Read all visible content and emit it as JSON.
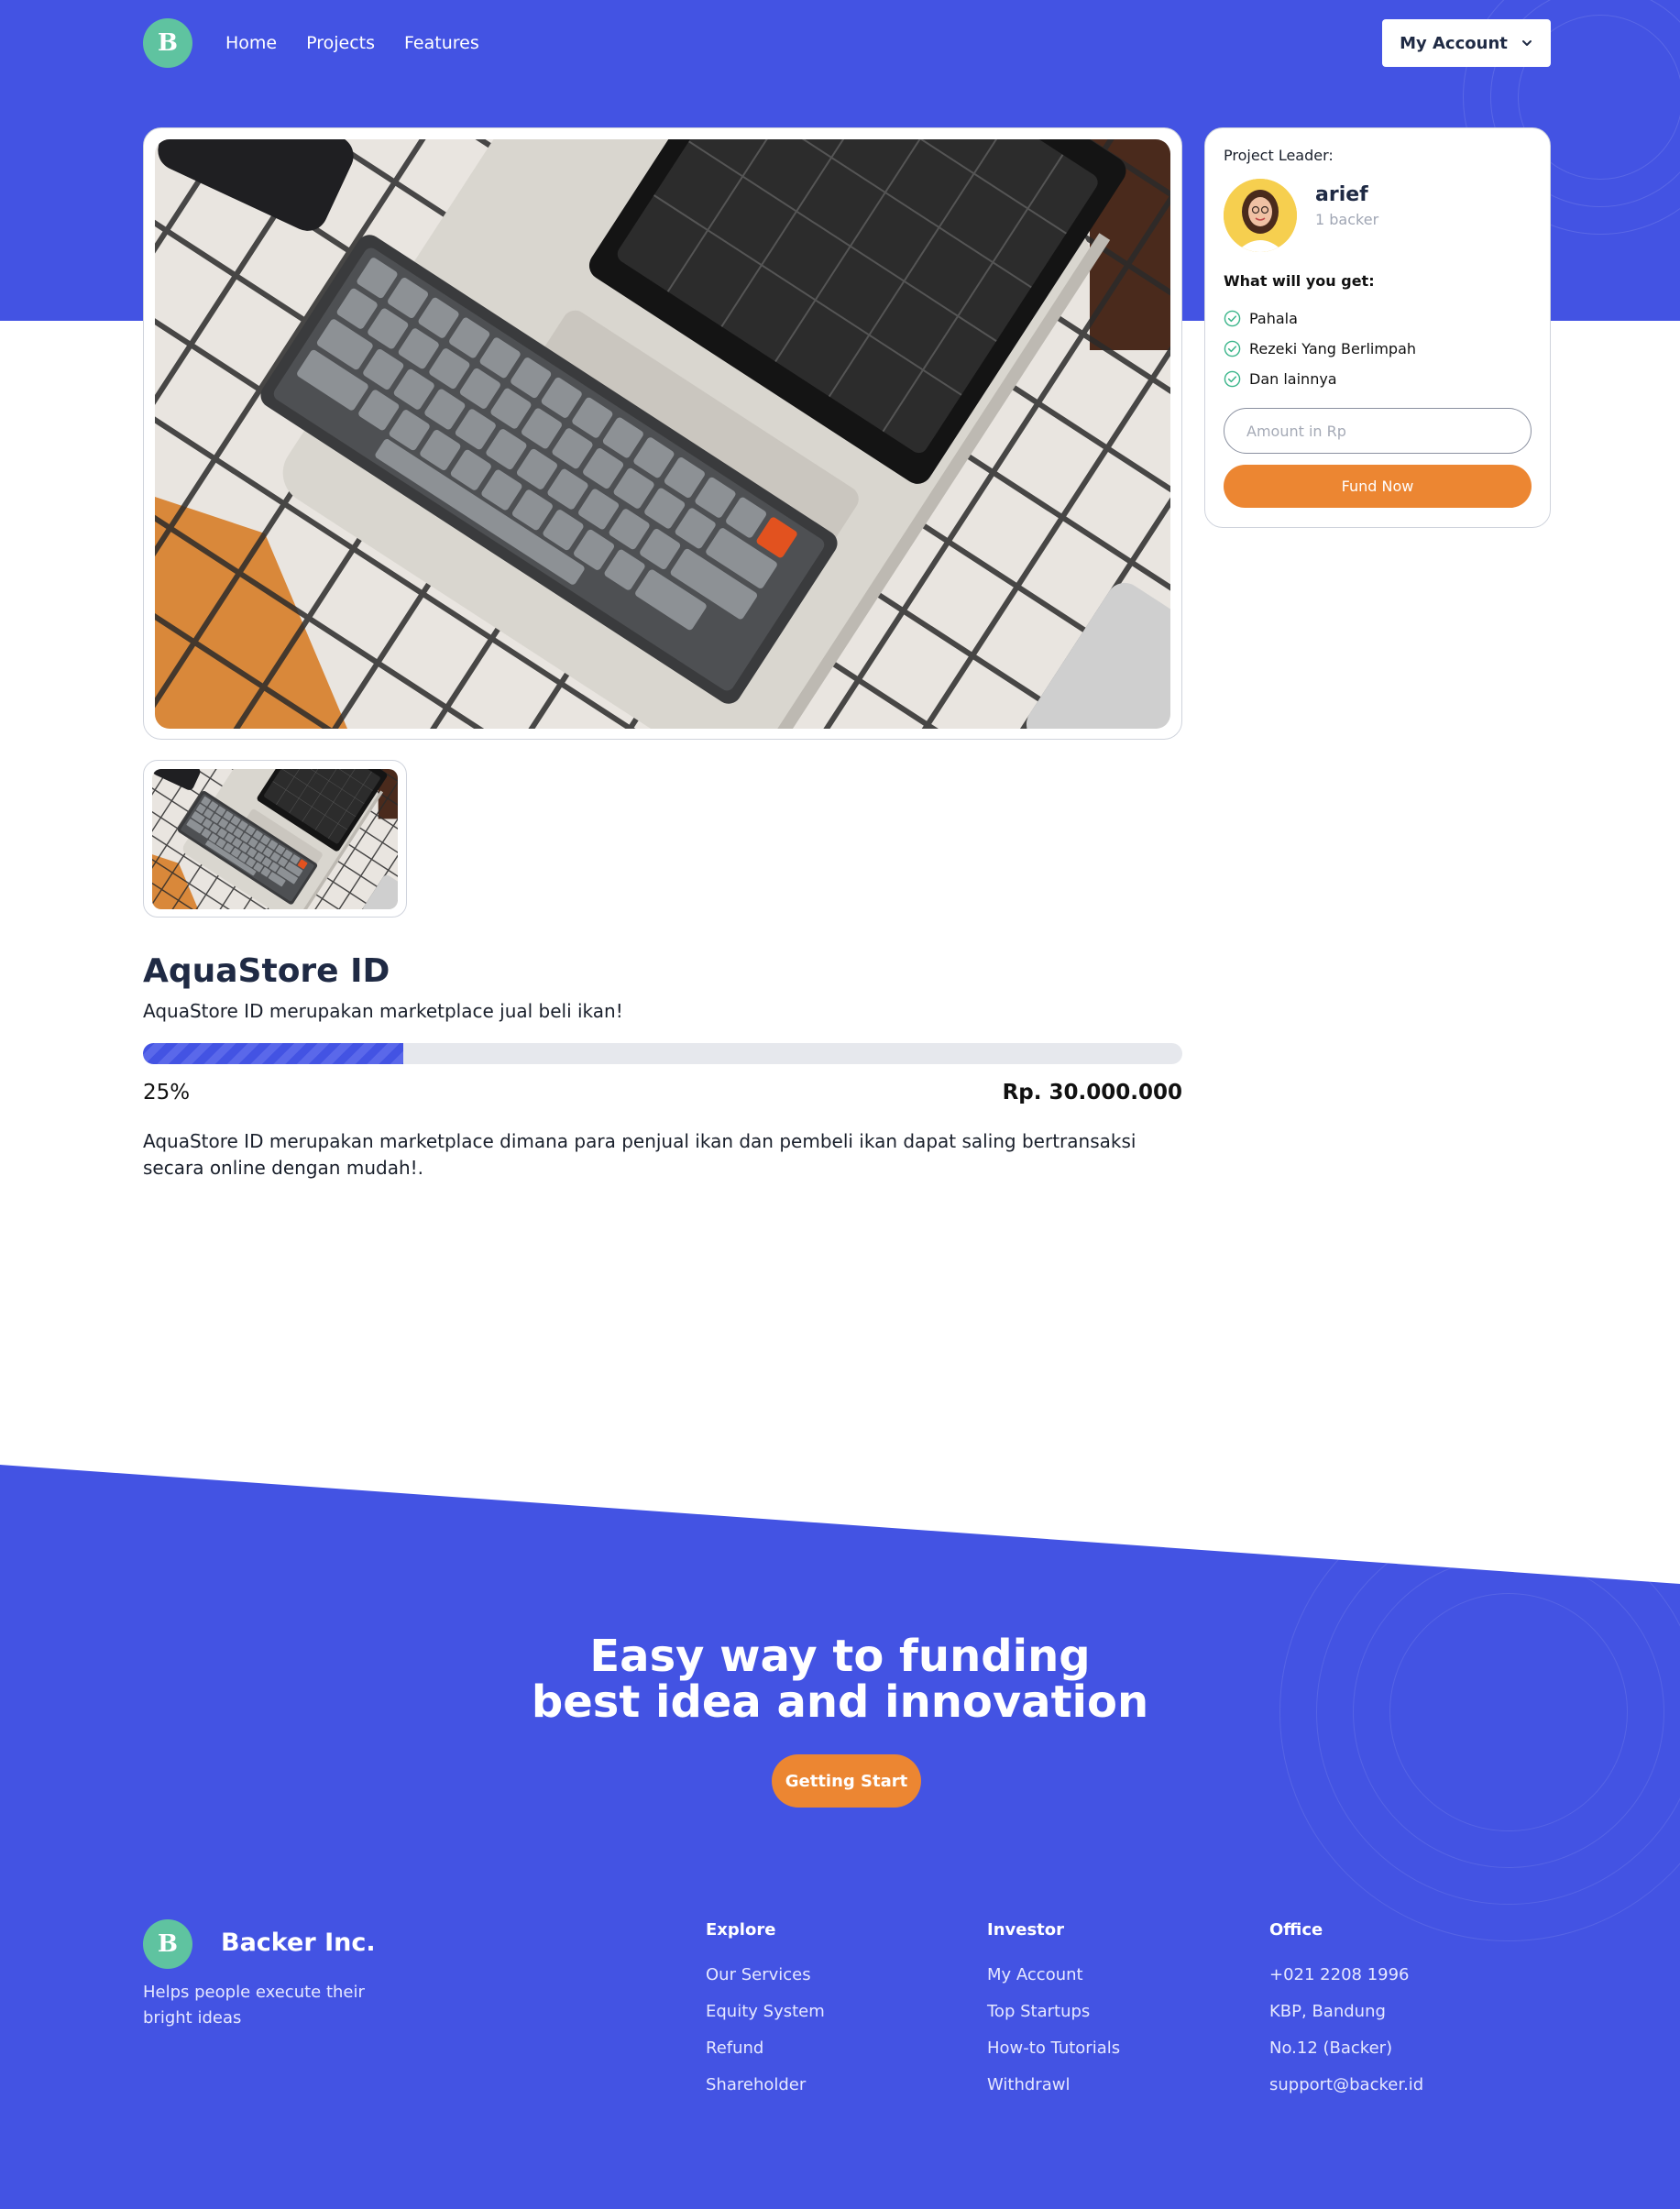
{
  "nav": {
    "logo_letter": "B",
    "links": [
      "Home",
      "Projects",
      "Features"
    ],
    "account_label": "My Account"
  },
  "gallery": {
    "main_image": "keyboard-laptop-photo",
    "thumbnails": [
      "keyboard-laptop-photo"
    ]
  },
  "leader": {
    "label": "Project Leader:",
    "name": "arief",
    "backers": "1 backer"
  },
  "rewards": {
    "title": "What will you get:",
    "items": [
      "Pahala",
      "Rezeki Yang Berlimpah",
      "Dan lainnya"
    ]
  },
  "fund": {
    "placeholder": "Amount in Rp",
    "button": "Fund Now"
  },
  "project": {
    "title": "AquaStore ID",
    "short_description": "AquaStore ID merupakan marketplace jual beli ikan!",
    "progress": 0.25,
    "progress_label": "25%",
    "goal": "Rp. 30.000.000",
    "description": "AquaStore ID merupakan marketplace dimana para penjual ikan dan pembeli ikan dapat saling bertransaksi secara online dengan mudah!."
  },
  "cta": {
    "line1": "Easy way to funding",
    "line2": "best idea and innovation",
    "button": "Getting Start"
  },
  "footer": {
    "logo_letter": "B",
    "brand": "Backer Inc.",
    "tagline": "Helps people execute their bright ideas",
    "columns": [
      {
        "title": "Explore",
        "items": [
          "Our Services",
          "Equity System",
          "Refund",
          "Shareholder"
        ]
      },
      {
        "title": "Investor",
        "items": [
          "My Account",
          "Top Startups",
          "How-to Tutorials",
          "Withdrawl"
        ]
      },
      {
        "title": "Office",
        "items": [
          "+021 2208 1996",
          "KBP, Bandung",
          "No.12 (Backer)",
          "support@backer.id"
        ]
      }
    ]
  },
  "colors": {
    "brand_blue": "#4353e3",
    "accent_orange": "#ec8632",
    "logo_green": "#5fc3a0",
    "check_green": "#3bb58a"
  }
}
